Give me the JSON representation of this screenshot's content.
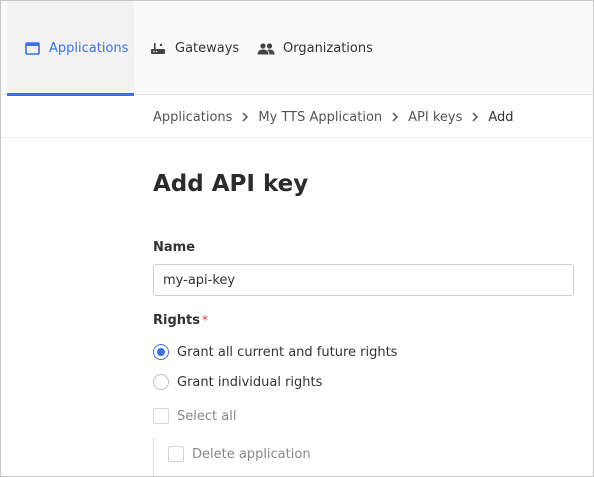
{
  "nav": {
    "tabs": [
      {
        "label": "Applications",
        "icon": "application-window-icon",
        "active": true
      },
      {
        "label": "Gateways",
        "icon": "router-icon",
        "active": false
      },
      {
        "label": "Organizations",
        "icon": "people-icon",
        "active": false
      }
    ]
  },
  "breadcrumb": {
    "items": [
      "Applications",
      "My TTS Application",
      "API keys",
      "Add"
    ]
  },
  "page": {
    "title": "Add API key"
  },
  "form": {
    "name_label": "Name",
    "name_value": "my-api-key",
    "rights_label": "Rights",
    "rights_required_mark": "*",
    "rights_options": [
      {
        "label": "Grant all current and future rights",
        "selected": true
      },
      {
        "label": "Grant individual rights",
        "selected": false
      }
    ],
    "select_all_label": "Select all",
    "rights_list": [
      {
        "label": "Delete application",
        "checked": false
      }
    ]
  },
  "colors": {
    "accent": "#3b71e8",
    "required": "#e23b3b"
  }
}
